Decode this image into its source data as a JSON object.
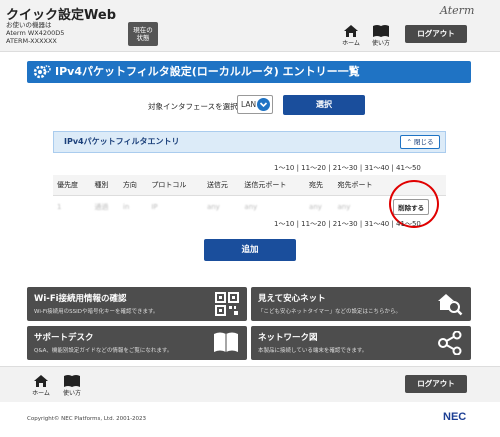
{
  "header": {
    "site_title": "クイック設定Web",
    "device_label": "お使いの機器は",
    "device_model": "Aterm WX4200D5",
    "device_id": "ATERM-XXXXXX",
    "status_button": [
      "現在の",
      "状態"
    ],
    "logo": "Aterm",
    "home_label": "ホーム",
    "manual_label": "使い方",
    "logout_label": "ログアウト"
  },
  "page": {
    "heading": "IPv4パケットフィルタ設定(ローカルルータ) エントリー一覧",
    "interface_label": "対象インタフェースを選択",
    "interface_value": "LAN",
    "select_button": "選択"
  },
  "section": {
    "title": "IPv4パケットフィルタエントリ",
    "collapse_label": "閉じる"
  },
  "pager": {
    "text": "1～10 | 11～20 | 21～30 | 31～40 | 41～50"
  },
  "table": {
    "headers": [
      "優先度",
      "種別",
      "方向",
      "プロトコル",
      "送信元",
      "送信元ポート",
      "宛先",
      "宛先ポート",
      ""
    ],
    "row": [
      "1",
      "通過",
      "in",
      "IP",
      "any",
      "any",
      "any",
      "any"
    ],
    "delete_label": "削除する"
  },
  "add_button": "追加",
  "tiles": [
    {
      "title": "Wi-Fi接続用情報の確認",
      "desc": "Wi-Fi接続用のSSIDや暗号化キーを確認できます。"
    },
    {
      "title": "見えて安心ネット",
      "desc": "「こども安心ネットタイマー」などの設定はこちらから。"
    },
    {
      "title": "サポートデスク",
      "desc": "Q&A、機能別設定ガイドなどの情報をご覧になれます。"
    },
    {
      "title": "ネットワーク図",
      "desc": "本製品に接続している端末を確認できます。"
    }
  ],
  "footer": {
    "home_label": "ホーム",
    "manual_label": "使い方",
    "logout_label": "ログアウト",
    "copyright": "Copyright© NEC Platforms, Ltd. 2001-2023",
    "brand": "NEC"
  }
}
